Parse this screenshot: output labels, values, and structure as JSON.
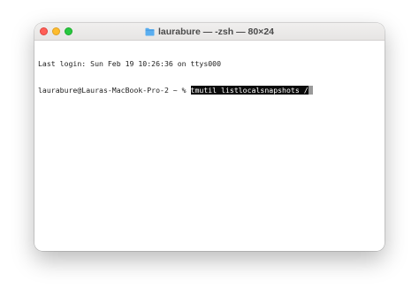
{
  "window": {
    "title": "laurabure — -zsh — 80×24",
    "folder_icon": "folder-icon"
  },
  "terminal": {
    "last_login": "Last login: Sun Feb 19 10:26:36 on ttys000",
    "prompt": "laurabure@Lauras-MacBook-Pro-2 ~ % ",
    "command": "tmutil listlocalsnapshots /"
  },
  "colors": {
    "close": "#ff5f57",
    "minimize": "#febc2e",
    "maximize": "#28c840",
    "folder": "#5aaef0",
    "selection_bg": "#0b0b0b"
  }
}
